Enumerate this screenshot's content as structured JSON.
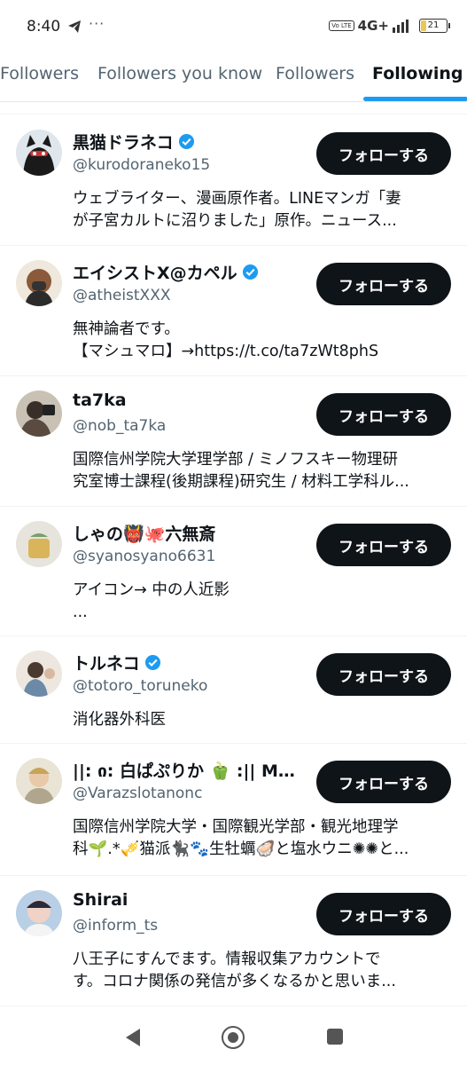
{
  "status_bar": {
    "time": "8:40",
    "volte": "Vo LTE",
    "network": "4G+",
    "battery": "21",
    "battery_level": 0.21
  },
  "tabs": [
    {
      "label": "Followers",
      "active": false
    },
    {
      "label": "Followers you know",
      "active": false
    },
    {
      "label": "Followers",
      "active": false
    },
    {
      "label": "Following",
      "active": true
    }
  ],
  "accent_color": "#1d9bf0",
  "follow_label": "フォローする",
  "users": [
    {
      "name": "黒猫ドラネコ",
      "verified": true,
      "handle": "@kurodoraneko15",
      "bio": [
        "ウェブライター、漫画原作者。LINEマンガ「妻",
        "が子宮カルトに沼りました」原作。ニュース..."
      ],
      "follow_label": "フォローする"
    },
    {
      "name": "エイシストX@カペル",
      "verified": true,
      "handle": "@atheistXXX",
      "bio": [
        "無神論者です。",
        "【マシュマロ】→https://t.co/ta7zWt8phS"
      ],
      "follow_label": "フォローする"
    },
    {
      "name": "ta7ka",
      "verified": false,
      "handle": "@nob_ta7ka",
      "bio": [
        "国際信州学院大学理学部 / ミノフスキー物理研",
        "究室博士課程(後期課程)研究生 / 材料工学科ル..."
      ],
      "follow_label": "フォローする"
    },
    {
      "name": "しゃの👹🐙六無斎",
      "verified": false,
      "handle": "@syanosyano6631",
      "bio": [
        "アイコン→ 中の人近影",
        "..."
      ],
      "follow_label": "フォローする"
    },
    {
      "name": "トルネコ",
      "verified": true,
      "handle": "@totoro_toruneko",
      "bio": [
        "消化器外科医"
      ],
      "follow_label": "フォローする"
    },
    {
      "name": "||: ი: 白ぱぷりか 🫑 :|| MMM...",
      "verified": false,
      "handle": "@Varazslotanonc",
      "bio": [
        "国際信州学院大学・国際観光学部・観光地理学",
        "科🌱.*🎺猫派🐈‍⬛🐾生牡蠣🦪と塩水ウニ✺✺と..."
      ],
      "follow_label": "フォローする"
    },
    {
      "name": "Shirai",
      "verified": false,
      "handle": "@inform_ts",
      "bio": [
        "八王子にすんでます。情報収集アカウントで",
        "す。コロナ関係の発信が多くなるかと思いま..."
      ],
      "follow_label": "フォローする"
    }
  ]
}
